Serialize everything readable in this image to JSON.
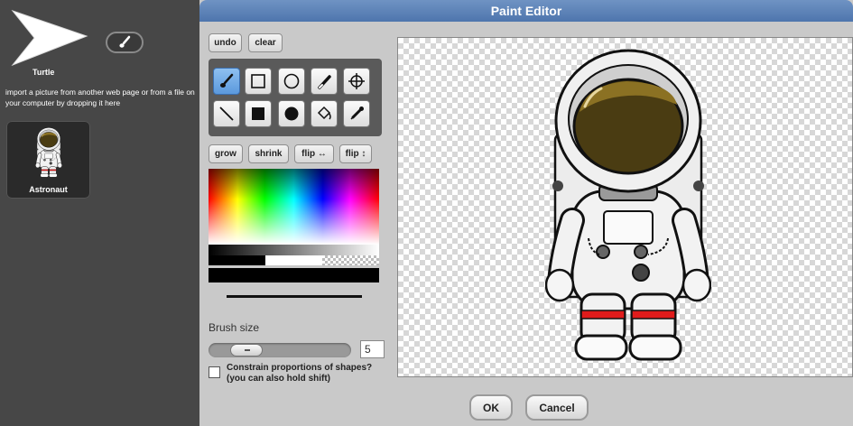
{
  "sprite": {
    "name": "Turtle",
    "import_hint": "import a picture from another web page or from a file on your computer by dropping it here",
    "costume_name": "Astronaut",
    "paintbrush_icon": "paintbrush-icon"
  },
  "dialog": {
    "title": "Paint Editor",
    "undo": "undo",
    "clear": "clear",
    "grow": "grow",
    "shrink": "shrink",
    "flip_h": "flip ↔",
    "flip_v": "flip ↕",
    "brush_size_label": "Brush size",
    "brush_size_value": "5",
    "brush_size_level": 0.2,
    "constrain_label_1": "Constrain proportions of shapes?",
    "constrain_label_2": "(you can also hold shift)",
    "ok": "OK",
    "cancel": "Cancel"
  },
  "tools": [
    {
      "name": "brush",
      "icon": "paintbrush-icon",
      "active": true
    },
    {
      "name": "rectangle outline",
      "icon": "rectangle-outline-icon"
    },
    {
      "name": "ellipse outline",
      "icon": "circle-outline-icon"
    },
    {
      "name": "eraser",
      "icon": "eraser-icon"
    },
    {
      "name": "rotation center",
      "icon": "crosshair-icon"
    },
    {
      "name": "line",
      "icon": "line-icon"
    },
    {
      "name": "filled rectangle",
      "icon": "filled-rectangle-icon"
    },
    {
      "name": "filled ellipse",
      "icon": "filled-circle-icon"
    },
    {
      "name": "paint bucket",
      "icon": "paint-bucket-icon"
    },
    {
      "name": "pipette",
      "icon": "pipette-icon"
    }
  ],
  "colors": {
    "selected": "#000000",
    "title_bar": "#5a80b8",
    "left_panel": "#474747"
  }
}
